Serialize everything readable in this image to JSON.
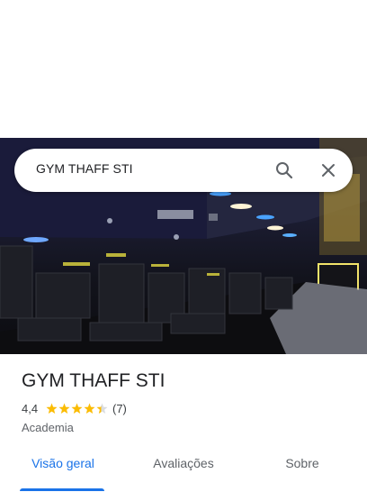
{
  "search": {
    "query": "GYM THAFF STI"
  },
  "icons": {
    "search": "search-icon",
    "close": "close-icon",
    "star": "star-icon"
  },
  "place": {
    "name": "GYM THAFF STI",
    "rating": "4,4",
    "stars": 4.4,
    "reviews": "(7)",
    "category": "Academia"
  },
  "tabs": [
    {
      "label": "Visão geral",
      "active": true
    },
    {
      "label": "Avaliações",
      "active": false
    },
    {
      "label": "Sobre",
      "active": false
    }
  ],
  "colors": {
    "accent": "#1a73e8",
    "star": "#fbbc04",
    "text": "#202124",
    "muted": "#5f6368"
  }
}
